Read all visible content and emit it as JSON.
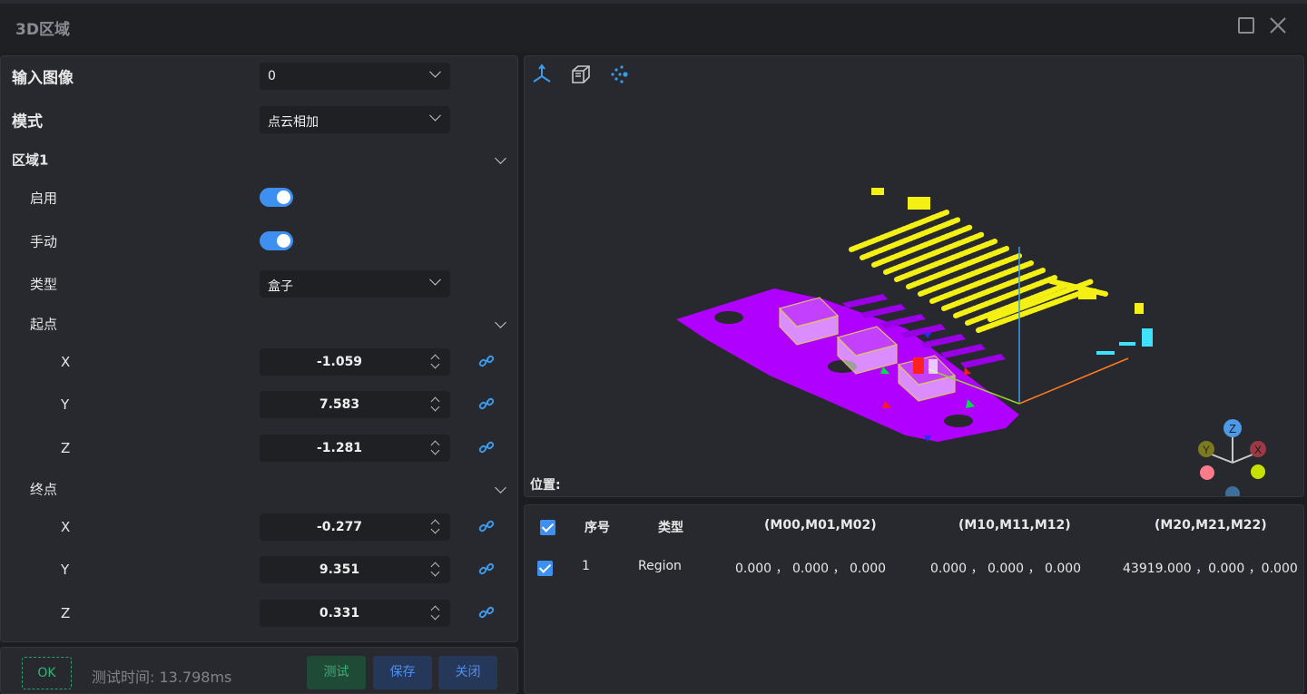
{
  "window": {
    "title": "3D区域"
  },
  "form": {
    "input_image": {
      "label": "输入图像",
      "value": "0"
    },
    "mode": {
      "label": "模式",
      "value": "点云相加"
    },
    "region": {
      "title": "区域1",
      "enable_label": "启用",
      "manual_label": "手动",
      "type_label": "类型",
      "type_value": "盒子",
      "start": {
        "title": "起点",
        "x_label": "X",
        "x": "-1.059",
        "y_label": "Y",
        "y": "7.583",
        "z_label": "Z",
        "z": "-1.281"
      },
      "end": {
        "title": "终点",
        "x_label": "X",
        "x": "-0.277",
        "y_label": "Y",
        "y": "9.351",
        "z_label": "Z",
        "z": "0.331"
      }
    }
  },
  "footer": {
    "ok": "OK",
    "test_time": "测试时间: 13.798ms",
    "test": "测试",
    "save": "保存",
    "close": "关闭"
  },
  "viewer": {
    "position_label": "位置:",
    "axis_x": "X",
    "axis_y": "Y",
    "axis_z": "Z"
  },
  "table": {
    "headers": [
      "序号",
      "类型",
      "(M00,M01,M02)",
      "(M10,M11,M12)",
      "(M20,M21,M22)"
    ],
    "rows": [
      {
        "index": "1",
        "type": "Region",
        "m0": "0.000 ， 0.000 ， 0.000",
        "m1": "0.000 ， 0.000 ， 0.000",
        "m2": "43919.000 ，0.000 ，0.000"
      }
    ]
  }
}
